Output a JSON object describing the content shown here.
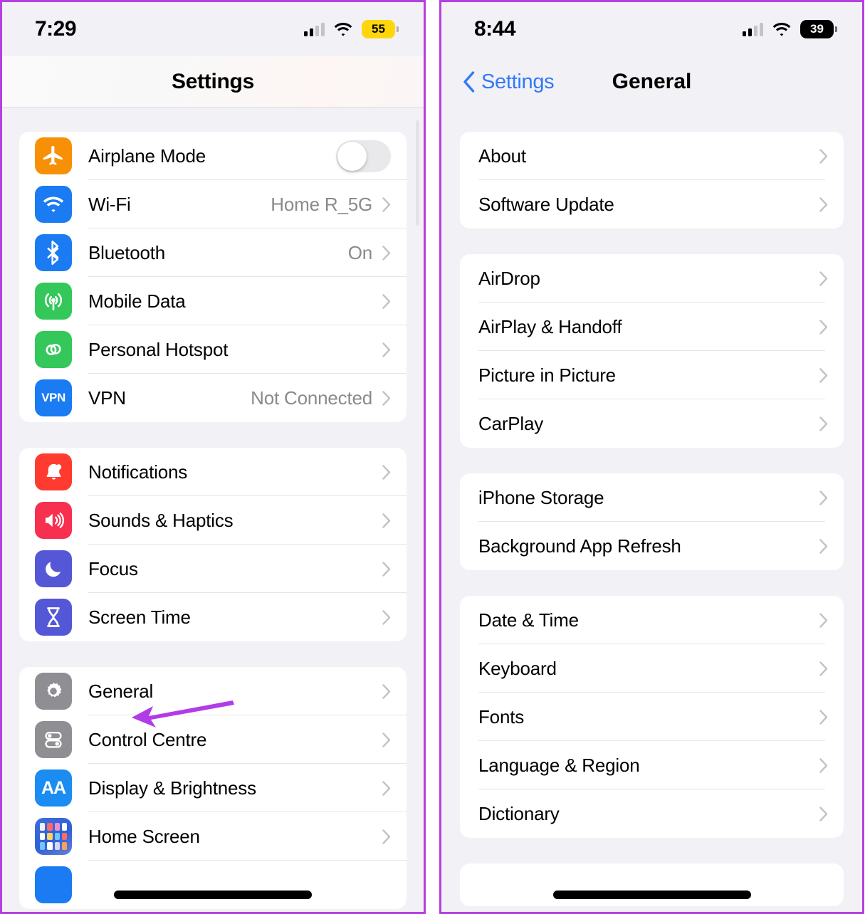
{
  "left_phone": {
    "status": {
      "time": "7:29",
      "battery": "55",
      "battery_style": "low-power-yellow",
      "signal_icon": "cellular-bars-icon",
      "wifi_icon": "wifi-icon"
    },
    "nav": {
      "title": "Settings"
    },
    "groups": [
      {
        "rows": [
          {
            "icon": "airplane-icon",
            "icon_color": "#f79007",
            "label": "Airplane Mode",
            "control": "toggle",
            "toggle_on": false
          },
          {
            "icon": "wifi-icon",
            "icon_color": "#1a7bf2",
            "label": "Wi-Fi",
            "value": "Home R_5G",
            "control": "chevron"
          },
          {
            "icon": "bluetooth-icon",
            "icon_color": "#1a7bf2",
            "label": "Bluetooth",
            "value": "On",
            "control": "chevron"
          },
          {
            "icon": "cellular-tower-icon",
            "icon_color": "#34c759",
            "label": "Mobile Data",
            "value": "",
            "control": "chevron"
          },
          {
            "icon": "hotspot-link-icon",
            "icon_color": "#34c759",
            "label": "Personal Hotspot",
            "value": "",
            "control": "chevron"
          },
          {
            "icon": "vpn-icon",
            "icon_color": "#1a7bf2",
            "label": "VPN",
            "value": "Not Connected",
            "control": "chevron"
          }
        ]
      },
      {
        "rows": [
          {
            "icon": "bell-icon",
            "icon_color": "#ff3b30",
            "label": "Notifications",
            "value": "",
            "control": "chevron"
          },
          {
            "icon": "speaker-icon",
            "icon_color": "#f7304f",
            "label": "Sounds & Haptics",
            "value": "",
            "control": "chevron"
          },
          {
            "icon": "moon-icon",
            "icon_color": "#5457d6",
            "label": "Focus",
            "value": "",
            "control": "chevron"
          },
          {
            "icon": "hourglass-icon",
            "icon_color": "#5457d6",
            "label": "Screen Time",
            "value": "",
            "control": "chevron"
          }
        ]
      },
      {
        "rows": [
          {
            "icon": "gear-icon",
            "icon_color": "#8e8e93",
            "label": "General",
            "value": "",
            "control": "chevron"
          },
          {
            "icon": "control-centre-icon",
            "icon_color": "#8e8e93",
            "label": "Control Centre",
            "value": "",
            "control": "chevron"
          },
          {
            "icon": "display-aa-icon",
            "icon_color": "#1a8cf2",
            "label": "Display & Brightness",
            "value": "",
            "control": "chevron"
          },
          {
            "icon": "home-screen-grid-icon",
            "icon_color": "#3b6fe0",
            "label": "Home Screen",
            "value": "",
            "control": "chevron"
          }
        ]
      }
    ]
  },
  "right_phone": {
    "status": {
      "time": "8:44",
      "battery": "39",
      "battery_style": "dark",
      "signal_icon": "cellular-bars-icon",
      "wifi_icon": "wifi-icon"
    },
    "nav": {
      "back_label": "Settings",
      "title": "General"
    },
    "groups": [
      {
        "rows": [
          {
            "label": "About"
          },
          {
            "label": "Software Update"
          }
        ]
      },
      {
        "rows": [
          {
            "label": "AirDrop"
          },
          {
            "label": "AirPlay & Handoff"
          },
          {
            "label": "Picture in Picture"
          },
          {
            "label": "CarPlay"
          }
        ]
      },
      {
        "rows": [
          {
            "label": "iPhone Storage"
          },
          {
            "label": "Background App Refresh"
          }
        ]
      },
      {
        "rows": [
          {
            "label": "Date & Time"
          },
          {
            "label": "Keyboard"
          },
          {
            "label": "Fonts"
          },
          {
            "label": "Language & Region"
          },
          {
            "label": "Dictionary"
          }
        ]
      }
    ]
  },
  "annotations": {
    "color": "#b13ce8",
    "arrow_left_target": "General",
    "arrow_right_target": "Keyboard"
  }
}
